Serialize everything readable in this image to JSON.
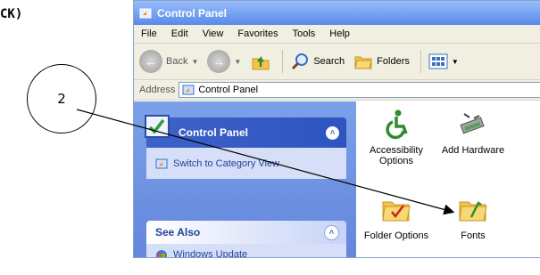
{
  "doc": {
    "text": "CK)"
  },
  "callout": {
    "number": "2"
  },
  "window": {
    "title": "Control Panel",
    "menu": [
      "File",
      "Edit",
      "View",
      "Favorites",
      "Tools",
      "Help"
    ],
    "toolbar": {
      "back": "Back",
      "search": "Search",
      "folders": "Folders"
    },
    "address": {
      "label": "Address",
      "value": "Control Panel"
    }
  },
  "taskpane": {
    "panel_title": "Control Panel",
    "switch_link": "Switch to Category View",
    "see_also_title": "See Also",
    "windows_update": "Windows Update"
  },
  "items": [
    {
      "label": "Accessibility Options",
      "icon": "accessibility-icon"
    },
    {
      "label": "Add Hardware",
      "icon": "add-hardware-icon"
    },
    {
      "label": "Folder Options",
      "icon": "folder-options-icon"
    },
    {
      "label": "Fonts",
      "icon": "fonts-folder-icon"
    }
  ],
  "colors": {
    "titlebar": "#5a8ae8",
    "taskpane": "#6d8fe0",
    "link": "#21439c"
  }
}
